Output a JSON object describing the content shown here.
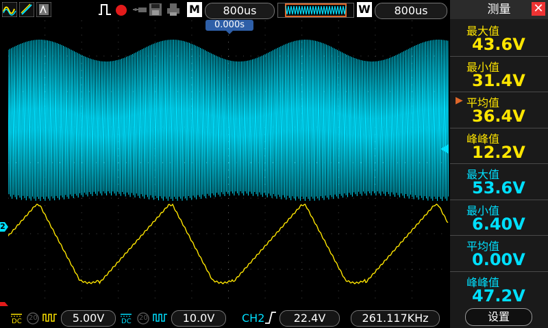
{
  "toolbar": {
    "timebase_label": "M",
    "timebase_value": "800us",
    "window_label": "W",
    "window_value": "800us"
  },
  "plot": {
    "trigger_position": "0.000s",
    "ch1_marker": "",
    "ch2_marker": "2"
  },
  "panel": {
    "title": "测量",
    "measurements": [
      {
        "label": "最大值",
        "value": "43.6V",
        "channel": "yellow",
        "selected": false
      },
      {
        "label": "最小值",
        "value": "31.4V",
        "channel": "yellow",
        "selected": false
      },
      {
        "label": "平均值",
        "value": "36.4V",
        "channel": "yellow",
        "selected": true
      },
      {
        "label": "峰峰值",
        "value": "12.2V",
        "channel": "yellow",
        "selected": false
      },
      {
        "label": "最大值",
        "value": "53.6V",
        "channel": "cyan",
        "selected": false
      },
      {
        "label": "最小值",
        "value": "6.40V",
        "channel": "cyan",
        "selected": false
      },
      {
        "label": "平均值",
        "value": "0.00V",
        "channel": "cyan",
        "selected": false
      },
      {
        "label": "峰峰值",
        "value": "47.2V",
        "channel": "cyan",
        "selected": false
      }
    ],
    "settings_label": "设置"
  },
  "bottombar": {
    "ch1_coupling": "DC",
    "ch1_bw": "20",
    "ch1_scale": "5.00V",
    "ch2_coupling": "DC",
    "ch2_bw": "20",
    "ch2_scale": "10.0V",
    "trigger_source": "CH2",
    "trigger_level": "22.4V",
    "frequency": "261.117KHz"
  },
  "colors": {
    "ch1": "#ffe600",
    "ch2": "#00e0ff",
    "grid": "#4a4a4a",
    "marker_blue": "#2e5fa8",
    "close_red": "#e33333"
  },
  "icons": [
    "run-mode-icon",
    "pen-icon",
    "persist-icon",
    "trigger-edge-icon",
    "record-icon",
    "probe-icon",
    "save-icon",
    "print-icon",
    "close-icon",
    "arrow-right-icon",
    "dc-coupling-icon",
    "bw-limit-icon",
    "rise-edge-icon"
  ]
}
